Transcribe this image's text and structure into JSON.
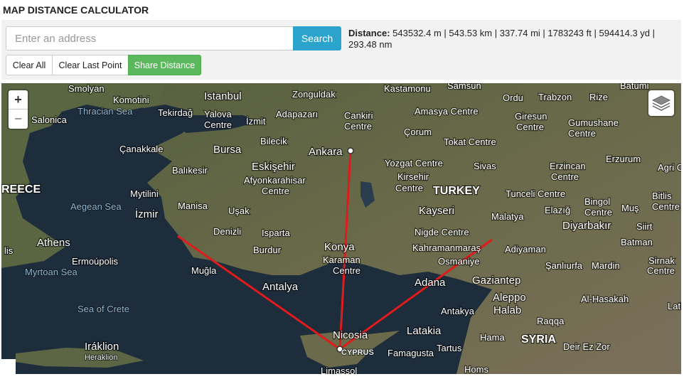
{
  "header": {
    "title": "MAP DISTANCE CALCULATOR"
  },
  "search": {
    "placeholder": "Enter an address",
    "button_label": "Search"
  },
  "actions": {
    "clear_all": "Clear All",
    "clear_last": "Clear Last Point",
    "share": "Share Distance"
  },
  "distance": {
    "label": "Distance:",
    "value": "543532.4 m | 543.53 km | 337.74 mi | 1783243 ft | 594414.3 yd | 293.48 nm"
  },
  "map": {
    "zoom_in": "+",
    "zoom_out": "−",
    "colors": {
      "route": "#e01b1b",
      "land": "#5a6642",
      "sea": "#1d2d3c"
    },
    "labels": {
      "smolyan": "Smolyan",
      "komotini": "Komotini",
      "istanbul": "Istanbul",
      "zonguldak": "Zonguldak",
      "kastamonu": "Kastamonu",
      "samsun": "Samsun",
      "ordu": "Ordu",
      "trabzon": "Trabzon",
      "rize": "Rize",
      "batumi": "Batumi",
      "salonica": "Salonica",
      "thracian_sea": "Thracian Sea",
      "tekirdag": "Tekirdağ",
      "yalova": "Yalova",
      "yalova2": "Centre",
      "adapazari": "Adapazarı",
      "cankiri": "Cankiri",
      "cankiri2": "Centre",
      "amasya": "Amasya Centre",
      "giresun": "Giresun",
      "giresun2": "Centre",
      "gumushane": "Gumushane",
      "gumushane2": "Centre",
      "izmit": "İzmit",
      "bilecik": "Bilecik",
      "corum": "Çorum",
      "tokat": "Tokat Centre",
      "canakkale": "Çanakkale",
      "bursa": "Bursa",
      "ankara": "Ankara",
      "erzurum": "Erzurum",
      "eskisehir": "Eskişehir",
      "yozgat": "Yozgat Centre",
      "kirsehir": "Kirsehir",
      "kirsehir2": "Centre",
      "sivas": "Sivas",
      "erzincan": "Erzincan",
      "erzincan2": "Centre",
      "agri": "Agri Ce",
      "balikesir": "Balıkesir",
      "afyon": "Afyonkarahisar",
      "afyon2": "Centre",
      "greece": "REECE",
      "mytilini": "Mytilini",
      "turkey": "TURKEY",
      "tunceli": "Tunceli Centre",
      "bingol": "Bingol",
      "bingol2": "Centre",
      "bitlis": "Bitlis",
      "bitlis2": "Centre",
      "aegean": "Aegean Sea",
      "manisa": "Manisa",
      "usak": "Uşak",
      "kayseri": "Kayseri",
      "elazig": "Elazığ",
      "mus": "Muş",
      "izmir": "İzmir",
      "malatya": "Malatya",
      "denizli": "Denizli",
      "isparta": "Isparta",
      "nigde": "Nigde Centre",
      "diyarbakir": "Diyarbakır",
      "siirt": "Siirt",
      "athens": "Athens",
      "konya": "Konya",
      "burdur": "Burdur",
      "kahramanmaras": "Kahramanmaraş",
      "adiyaman": "Adiyaman",
      "batman": "Batman",
      "karaman": "Karaman",
      "karaman2": "Centre",
      "osmaniye": "Osmaniye",
      "sanliurfa": "Şanlıurfa",
      "mardin": "Mardin",
      "sirnak": "Sirnak",
      "sirnak2": "Centre",
      "ermoupolis": "Ermoúpolis",
      "mugla": "Muğla",
      "myrtoan": "Myrtoan Sea",
      "gaziantep": "Gaziantep",
      "adana": "Adana",
      "antalya": "Antalya",
      "aleppo": "Aleppo",
      "aleppo2": "Halab",
      "sea_of_crete": "Sea of Crete",
      "antakya": "Antakya",
      "al_hasakah": "Al-Hasakah",
      "raqqa": "Raqqa",
      "lati": "Lati",
      "nicosia": "Nicosia",
      "latakia": "Latakia",
      "hama": "Hama",
      "syria": "SYRIA",
      "iraklion": "Iráklion",
      "iraklion2": "Heraklion",
      "cyprus": "CYPRUS",
      "famagusta": "Famagusta",
      "tartus": "Tartus",
      "deir_ez_zor": "Deir Ez Zor",
      "limassol": "Limassol",
      "homs": "Homs",
      "lis": "lis"
    }
  }
}
